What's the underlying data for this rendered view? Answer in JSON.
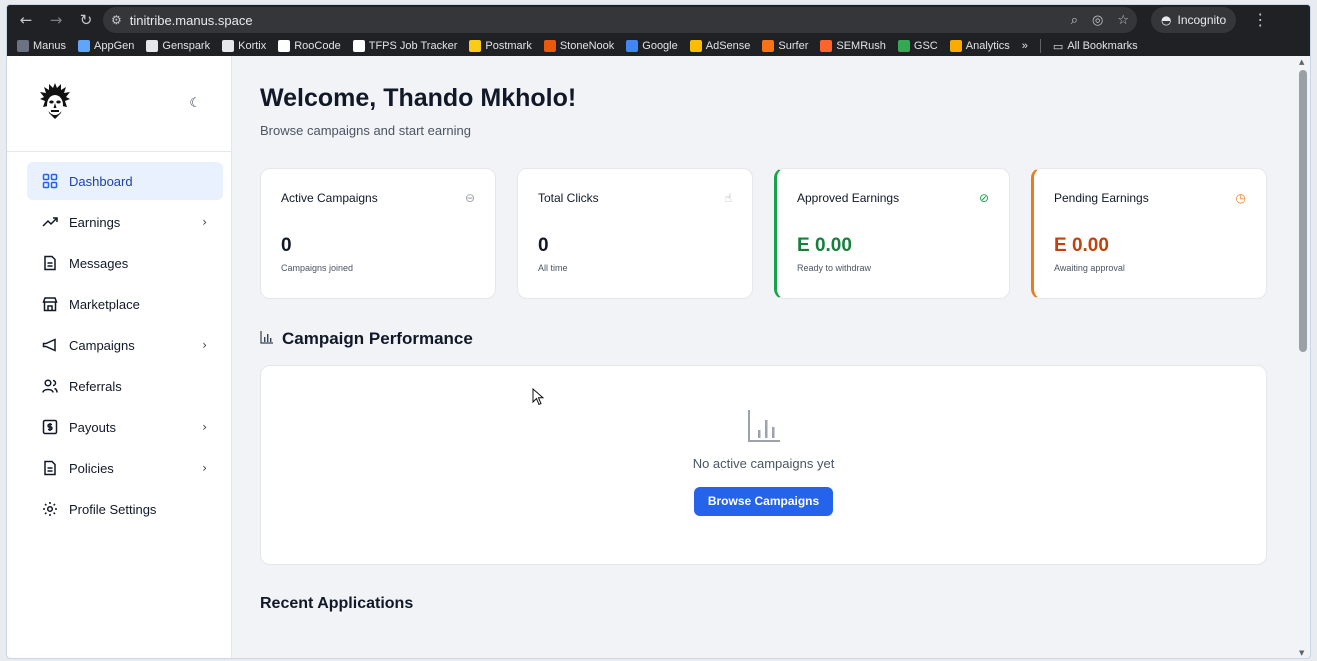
{
  "browser": {
    "url": "tinitribe.manus.space",
    "incognito_label": "Incognito",
    "bookmarks": [
      {
        "label": "Manus",
        "icon": "manus-icon",
        "color": "#6b7280"
      },
      {
        "label": "AppGen",
        "icon": "appgen-icon",
        "color": "#60a5fa"
      },
      {
        "label": "Genspark",
        "icon": "genspark-icon",
        "color": "#e5e7eb"
      },
      {
        "label": "Kortix",
        "icon": "kortix-icon",
        "color": "#e5e7eb"
      },
      {
        "label": "RooCode",
        "icon": "roocode-icon",
        "color": "#ffffff"
      },
      {
        "label": "TFPS Job Tracker",
        "icon": "tfps-icon",
        "color": "#ffffff"
      },
      {
        "label": "Postmark",
        "icon": "postmark-icon",
        "color": "#facc15"
      },
      {
        "label": "StoneNook",
        "icon": "stonenook-icon",
        "color": "#ea580c"
      },
      {
        "label": "Google",
        "icon": "google-icon",
        "color": "#4285f4"
      },
      {
        "label": "AdSense",
        "icon": "adsense-icon",
        "color": "#fbbc04"
      },
      {
        "label": "Surfer",
        "icon": "surfer-icon",
        "color": "#f97316"
      },
      {
        "label": "SEMRush",
        "icon": "semrush-icon",
        "color": "#ff642d"
      },
      {
        "label": "GSC",
        "icon": "gsc-icon",
        "color": "#34a853"
      },
      {
        "label": "Analytics",
        "icon": "analytics-icon",
        "color": "#f9ab00"
      }
    ],
    "overflow_label": "»",
    "all_bookmarks_label": "All Bookmarks"
  },
  "sidebar": {
    "items": [
      {
        "label": "Dashboard",
        "icon": "dashboard-icon",
        "active": true,
        "chevron": false
      },
      {
        "label": "Earnings",
        "icon": "trending-up-icon",
        "active": false,
        "chevron": true
      },
      {
        "label": "Messages",
        "icon": "document-icon",
        "active": false,
        "chevron": false
      },
      {
        "label": "Marketplace",
        "icon": "store-icon",
        "active": false,
        "chevron": false
      },
      {
        "label": "Campaigns",
        "icon": "megaphone-icon",
        "active": false,
        "chevron": true
      },
      {
        "label": "Referrals",
        "icon": "users-icon",
        "active": false,
        "chevron": false
      },
      {
        "label": "Payouts",
        "icon": "dollar-icon",
        "active": false,
        "chevron": true
      },
      {
        "label": "Policies",
        "icon": "document-icon",
        "active": false,
        "chevron": true
      },
      {
        "label": "Profile Settings",
        "icon": "gear-icon",
        "active": false,
        "chevron": false
      }
    ]
  },
  "main": {
    "welcome": "Welcome, Thando Mkholo!",
    "subtitle": "Browse campaigns and start earning",
    "cards": [
      {
        "title": "Active Campaigns",
        "value": "0",
        "sub": "Campaigns joined",
        "icon": "link-icon",
        "accent": "#111827",
        "icon_color": "#9ca3af"
      },
      {
        "title": "Total Clicks",
        "value": "0",
        "sub": "All time",
        "icon": "pointer-click-icon",
        "accent": "#111827",
        "icon_color": "#9ca3af"
      },
      {
        "title": "Approved Earnings",
        "value": "E 0.00",
        "sub": "Ready to withdraw",
        "icon": "check-circle-icon",
        "accent": "#15803d",
        "icon_color": "#16a34a"
      },
      {
        "title": "Pending Earnings",
        "value": "E 0.00",
        "sub": "Awaiting approval",
        "icon": "clock-icon",
        "accent": "#c2410c",
        "icon_color": "#ea7c1b"
      }
    ],
    "performance_title": "Campaign Performance",
    "empty_text": "No active campaigns yet",
    "browse_button": "Browse Campaigns",
    "recent_title": "Recent Applications"
  }
}
